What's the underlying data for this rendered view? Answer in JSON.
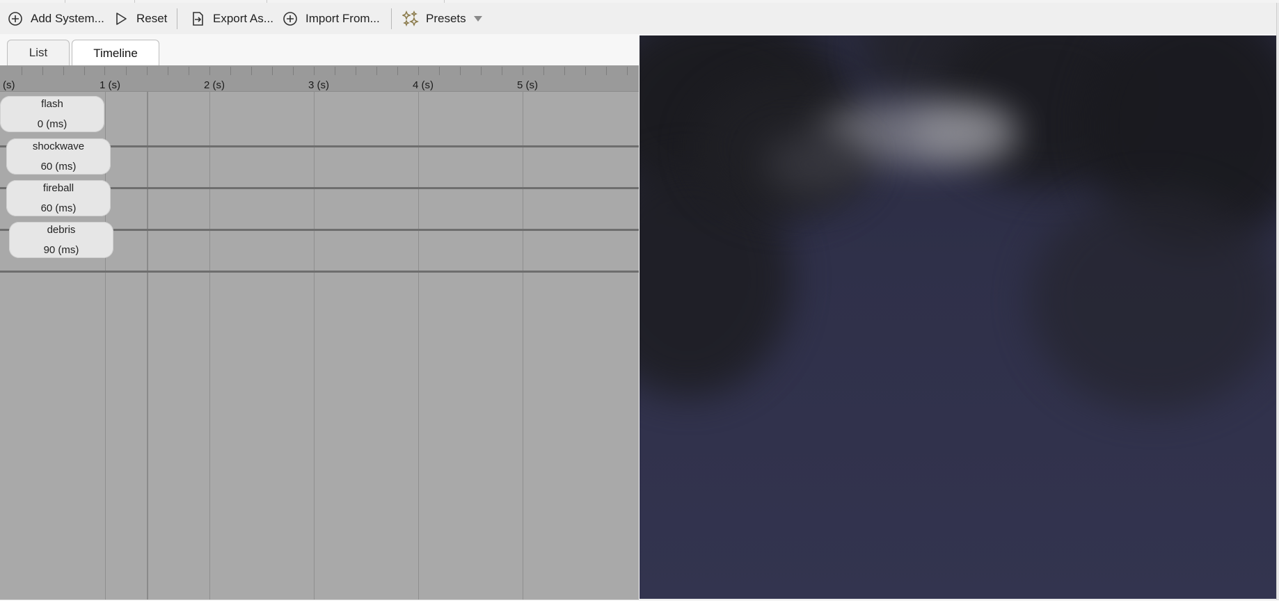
{
  "toolbar": {
    "add_system": "Add System...",
    "reset": "Reset",
    "export_as": "Export As...",
    "import_from": "Import From...",
    "presets": "Presets"
  },
  "tabs": [
    {
      "label": "List",
      "active": false
    },
    {
      "label": "Timeline",
      "active": true
    }
  ],
  "ruler": {
    "labels": [
      "(s)",
      "1 (s)",
      "2 (s)",
      "3 (s)",
      "4 (s)",
      "5 (s)"
    ]
  },
  "systems": [
    {
      "name": "flash",
      "delay": "0 (ms)"
    },
    {
      "name": "shockwave",
      "delay": "60 (ms)"
    },
    {
      "name": "fireball",
      "delay": "60 (ms)"
    },
    {
      "name": "debris",
      "delay": "90 (ms)"
    }
  ],
  "colors": {
    "timeline_bg": "#a9a9a9",
    "ruler_bg": "#9a9a9a",
    "pill_bg": "#e6e6e6",
    "viewport_sky": "#32334e",
    "toolbar_bg": "#efefef"
  }
}
